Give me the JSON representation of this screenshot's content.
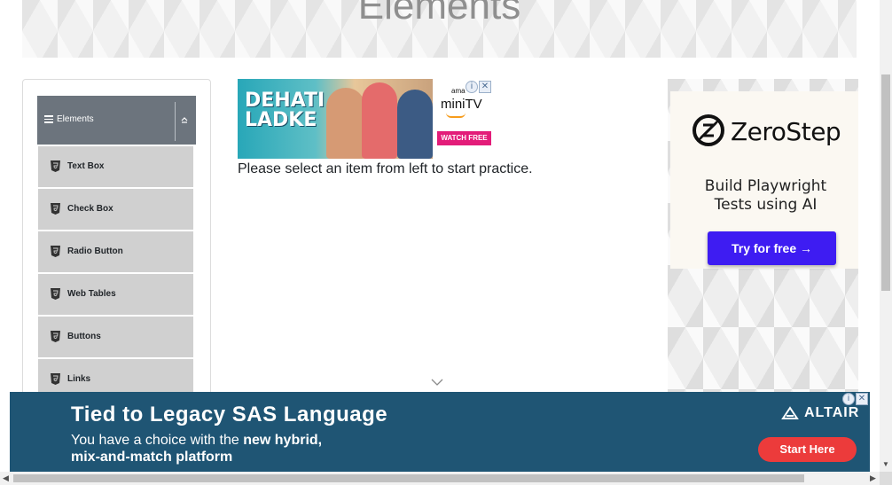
{
  "banner": {
    "title": "Elements"
  },
  "sidebar": {
    "group_label": "Elements",
    "items": [
      {
        "label": "Text Box"
      },
      {
        "label": "Check Box"
      },
      {
        "label": "Radio Button"
      },
      {
        "label": "Web Tables"
      },
      {
        "label": "Buttons"
      },
      {
        "label": "Links"
      }
    ]
  },
  "main": {
    "message": "Please select an item from left to start practice."
  },
  "top_ad": {
    "title_line1": "DEHATI",
    "title_line2": "LADKE",
    "brand_small": "ama",
    "brand": "miniTV",
    "cta": "WATCH FREE",
    "close_label": "✕",
    "info_label": "i"
  },
  "right_ad": {
    "brand": "ZeroStep",
    "tagline_line1": "Build Playwright",
    "tagline_line2": "Tests using AI",
    "cta": "Try for free →",
    "brand_color": "#3e1cf2"
  },
  "bottom_ad": {
    "headline": "Tied to Legacy SAS Language",
    "sub1_plain": "You have a choice with the ",
    "sub1_bold": "new hybrid,",
    "sub2": "mix-and-match platform",
    "brand": "ALTAIR",
    "cta": "Start Here",
    "close_label": "✕",
    "info_label": "i",
    "background_color": "#1f5574",
    "cta_color": "#ec3b3b"
  },
  "icons": {
    "menu": "hamburger-icon",
    "collapse": "chevron-up-icon",
    "item": "html5-icon",
    "more": "chevron-down-icon"
  }
}
